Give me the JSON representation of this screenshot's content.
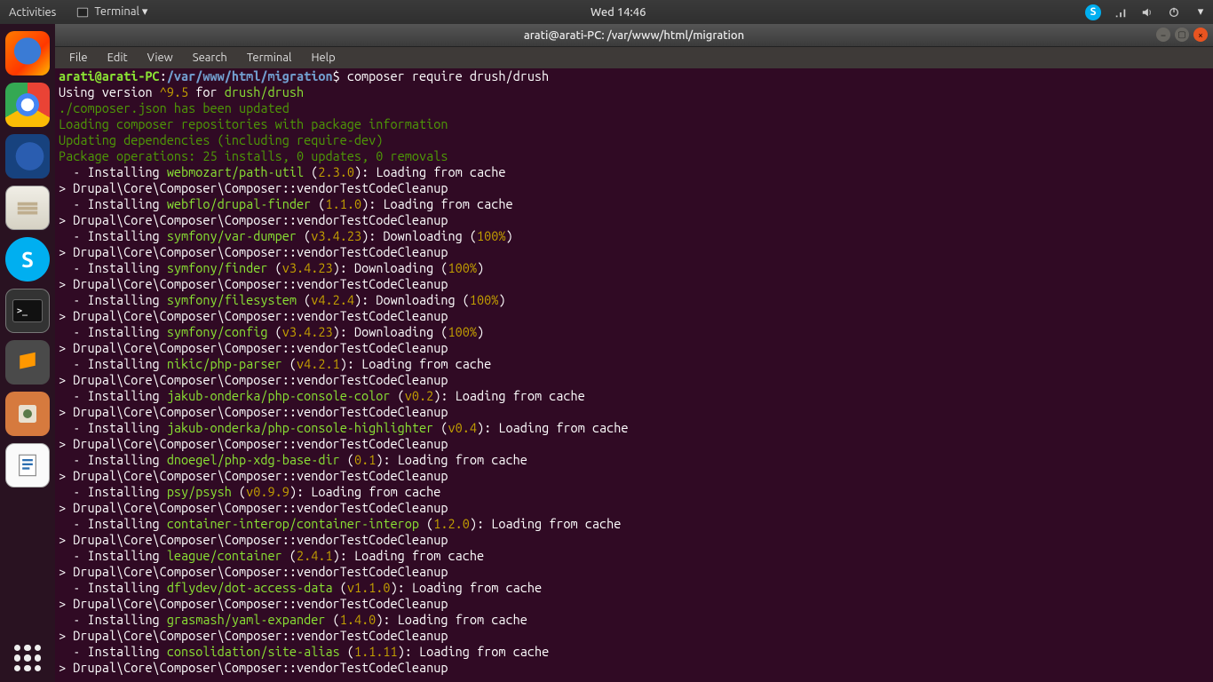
{
  "topbar": {
    "activities": "Activities",
    "app_menu": "Terminal ▾",
    "clock": "Wed 14:46"
  },
  "dock": {
    "items": [
      {
        "name": "firefox"
      },
      {
        "name": "chrome"
      },
      {
        "name": "thunderbird"
      },
      {
        "name": "files"
      },
      {
        "name": "skype"
      },
      {
        "name": "terminal"
      },
      {
        "name": "sublime"
      },
      {
        "name": "image-viewer"
      },
      {
        "name": "libreoffice-writer"
      }
    ]
  },
  "window": {
    "title": "arati@arati-PC: /var/www/html/migration",
    "menus": [
      "File",
      "Edit",
      "View",
      "Search",
      "Terminal",
      "Help"
    ]
  },
  "prompt": {
    "user": "arati@arati-PC",
    "path": "/var/www/html/migration",
    "dollar": "$",
    "command": "composer require drush/drush"
  },
  "lines": {
    "using_version_a": "Using version ",
    "using_version_b": "^9.5",
    "using_version_c": " for ",
    "using_version_d": "drush/drush",
    "json_updated": "./composer.json has been updated",
    "loading_repos": "Loading composer repositories with package information",
    "updating_deps": "Updating dependencies (including require-dev)",
    "pkg_ops": "Package operations: 25 installs, 0 updates, 0 removals",
    "cleanup": "> Drupal\\Core\\Composer\\Composer::vendorTestCodeCleanup",
    "installing": "  - Installing ",
    "loading_cache": "): Loading from cache",
    "downloading": "): Downloading (",
    "hundred": "100%",
    "close": ")"
  },
  "packages": [
    {
      "name": "webmozart/path-util",
      "ver": "2.3.0",
      "action": "cache"
    },
    {
      "name": "webflo/drupal-finder",
      "ver": "1.1.0",
      "action": "cache"
    },
    {
      "name": "symfony/var-dumper",
      "ver": "v3.4.23",
      "action": "download"
    },
    {
      "name": "symfony/finder",
      "ver": "v3.4.23",
      "action": "download"
    },
    {
      "name": "symfony/filesystem",
      "ver": "v4.2.4",
      "action": "download"
    },
    {
      "name": "symfony/config",
      "ver": "v3.4.23",
      "action": "download"
    },
    {
      "name": "nikic/php-parser",
      "ver": "v4.2.1",
      "action": "cache"
    },
    {
      "name": "jakub-onderka/php-console-color",
      "ver": "v0.2",
      "action": "cache"
    },
    {
      "name": "jakub-onderka/php-console-highlighter",
      "ver": "v0.4",
      "action": "cache"
    },
    {
      "name": "dnoegel/php-xdg-base-dir",
      "ver": "0.1",
      "action": "cache"
    },
    {
      "name": "psy/psysh",
      "ver": "v0.9.9",
      "action": "cache"
    },
    {
      "name": "container-interop/container-interop",
      "ver": "1.2.0",
      "action": "cache"
    },
    {
      "name": "league/container",
      "ver": "2.4.1",
      "action": "cache"
    },
    {
      "name": "dflydev/dot-access-data",
      "ver": "v1.1.0",
      "action": "cache"
    },
    {
      "name": "grasmash/yaml-expander",
      "ver": "1.4.0",
      "action": "cache"
    },
    {
      "name": "consolidation/site-alias",
      "ver": "1.1.11",
      "action": "cache"
    }
  ]
}
